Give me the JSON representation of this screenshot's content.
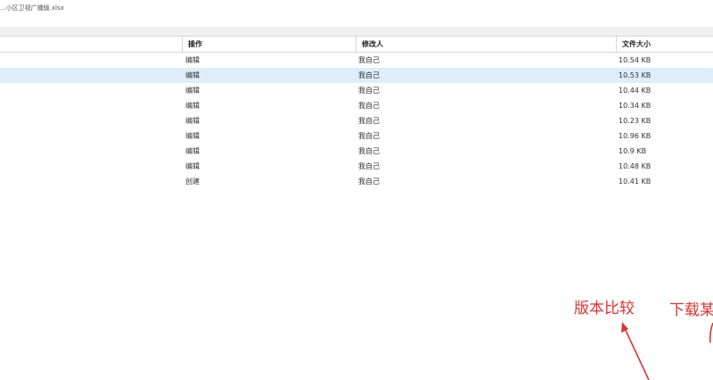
{
  "window": {
    "title": "...小区卫视广播版.xlsx"
  },
  "table": {
    "headers": {
      "action": "操作",
      "editor": "修改人",
      "size": "文件大小"
    },
    "rows": [
      {
        "action": "编辑",
        "editor": "我自己",
        "size": "10.54 KB",
        "selected": false
      },
      {
        "action": "编辑",
        "editor": "我自己",
        "size": "10.53 KB",
        "selected": true
      },
      {
        "action": "编辑",
        "editor": "我自己",
        "size": "10.44 KB",
        "selected": false
      },
      {
        "action": "编辑",
        "editor": "我自己",
        "size": "10.34 KB",
        "selected": false
      },
      {
        "action": "编辑",
        "editor": "我自己",
        "size": "10.23 KB",
        "selected": false
      },
      {
        "action": "编辑",
        "editor": "我自己",
        "size": "10.96 KB",
        "selected": false
      },
      {
        "action": "编辑",
        "editor": "我自己",
        "size": "10.9 KB",
        "selected": false
      },
      {
        "action": "编辑",
        "editor": "我自己",
        "size": "10.48 KB",
        "selected": false
      },
      {
        "action": "创建",
        "editor": "我自己",
        "size": "10.41 KB",
        "selected": false
      }
    ]
  },
  "annotations": {
    "compare_label": "版本比较",
    "download_label": "下载某",
    "color": "#e0322e"
  },
  "colors": {
    "selected_row": "#ddeefa",
    "header_border": "#d6d6d6"
  }
}
